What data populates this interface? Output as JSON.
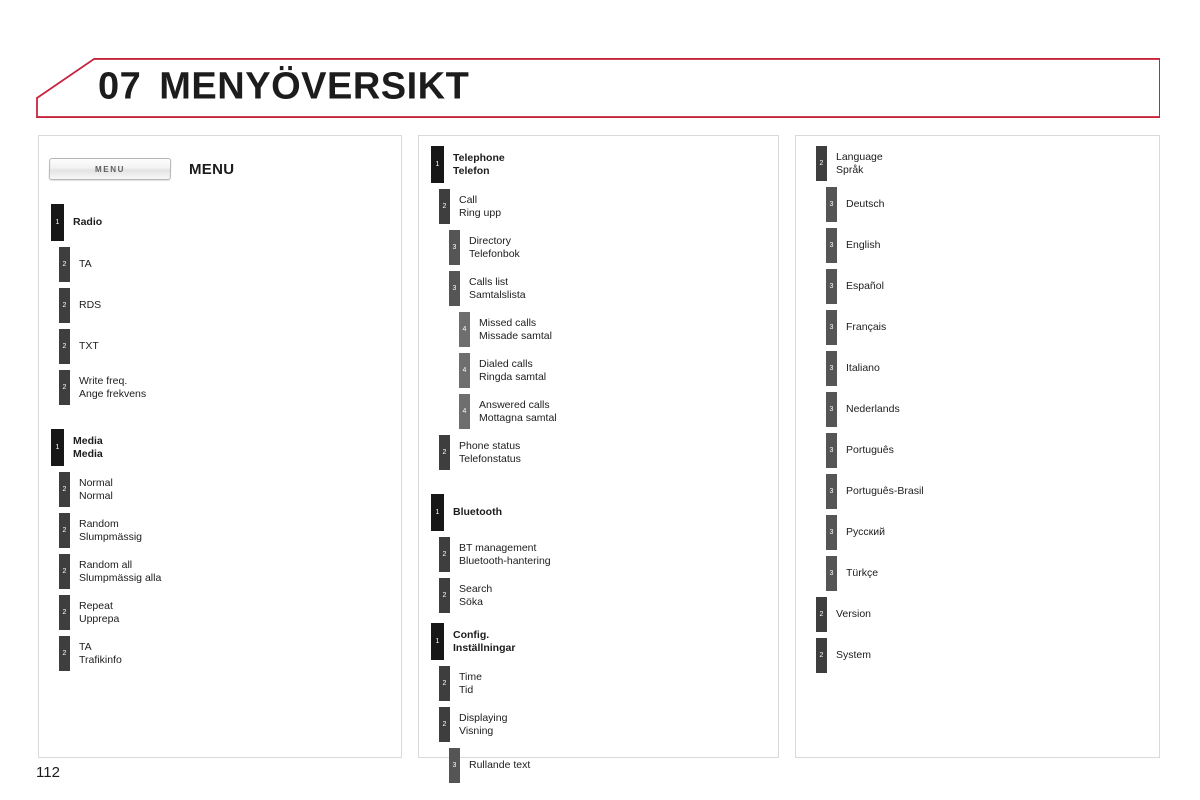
{
  "header": {
    "chapter_number": "07",
    "title": "MENYÖVERSIKT",
    "accent_color": "#c8243f"
  },
  "page_number": "112",
  "column1": {
    "menu_button_label": "MENU",
    "menu_heading": "MENU",
    "items": [
      {
        "level": 1,
        "en": "Radio",
        "sv": "",
        "gap": "none"
      },
      {
        "level": 2,
        "en": "TA",
        "sv": "",
        "gap": "none"
      },
      {
        "level": 2,
        "en": "RDS",
        "sv": "",
        "gap": "none"
      },
      {
        "level": 2,
        "en": "TXT",
        "sv": "",
        "gap": "none"
      },
      {
        "level": 2,
        "en": "Write freq.",
        "sv": "Ange frekvens",
        "gap": "none"
      },
      {
        "level": 1,
        "en": "Media",
        "sv": "Media",
        "gap": "large"
      },
      {
        "level": 2,
        "en": "Normal",
        "sv": "Normal",
        "gap": "none"
      },
      {
        "level": 2,
        "en": "Random",
        "sv": "Slumpmässig",
        "gap": "none"
      },
      {
        "level": 2,
        "en": "Random all",
        "sv": "Slumpmässig alla",
        "gap": "none"
      },
      {
        "level": 2,
        "en": "Repeat",
        "sv": "Upprepa",
        "gap": "none"
      },
      {
        "level": 2,
        "en": "TA",
        "sv": "Trafikinfo",
        "gap": "none"
      }
    ]
  },
  "column2": {
    "items": [
      {
        "level": 1,
        "en": "Telephone",
        "sv": "Telefon",
        "gap": "none"
      },
      {
        "level": 2,
        "en": "Call",
        "sv": "Ring upp",
        "gap": "none"
      },
      {
        "level": 3,
        "en": "Directory",
        "sv": "Telefonbok",
        "gap": "none"
      },
      {
        "level": 3,
        "en": "Calls list",
        "sv": "Samtalslista",
        "gap": "none"
      },
      {
        "level": 4,
        "en": "Missed calls",
        "sv": "Missade samtal",
        "gap": "none"
      },
      {
        "level": 4,
        "en": "Dialed calls",
        "sv": "Ringda samtal",
        "gap": "none"
      },
      {
        "level": 4,
        "en": "Answered calls",
        "sv": "Mottagna samtal",
        "gap": "none"
      },
      {
        "level": 2,
        "en": "Phone status",
        "sv": "Telefonstatus",
        "gap": "none"
      },
      {
        "level": 1,
        "en": "Bluetooth",
        "sv": "",
        "gap": "large"
      },
      {
        "level": 2,
        "en": "BT management",
        "sv": "Bluetooth-hantering",
        "gap": "none"
      },
      {
        "level": 2,
        "en": "Search",
        "sv": "Söka",
        "gap": "none"
      },
      {
        "level": 1,
        "en": "Config.",
        "sv": "Inställningar",
        "gap": "small"
      },
      {
        "level": 2,
        "en": "Time",
        "sv": "Tid",
        "gap": "none"
      },
      {
        "level": 2,
        "en": "Displaying",
        "sv": "Visning",
        "gap": "none"
      },
      {
        "level": 3,
        "en": "Rullande text",
        "sv": "",
        "gap": "none"
      }
    ]
  },
  "column3": {
    "items": [
      {
        "level": 2,
        "en": "Language",
        "sv": "Språk",
        "gap": "none"
      },
      {
        "level": 3,
        "en": "Deutsch",
        "sv": "",
        "gap": "none"
      },
      {
        "level": 3,
        "en": "English",
        "sv": "",
        "gap": "none"
      },
      {
        "level": 3,
        "en": "Español",
        "sv": "",
        "gap": "none"
      },
      {
        "level": 3,
        "en": "Français",
        "sv": "",
        "gap": "none"
      },
      {
        "level": 3,
        "en": "Italiano",
        "sv": "",
        "gap": "none"
      },
      {
        "level": 3,
        "en": "Nederlands",
        "sv": "",
        "gap": "none"
      },
      {
        "level": 3,
        "en": "Português",
        "sv": "",
        "gap": "none"
      },
      {
        "level": 3,
        "en": "Português-Brasil",
        "sv": "",
        "gap": "none"
      },
      {
        "level": 3,
        "en": "Русский",
        "sv": "",
        "gap": "none"
      },
      {
        "level": 3,
        "en": "Türkçe",
        "sv": "",
        "gap": "none"
      },
      {
        "level": 2,
        "en": "Version",
        "sv": "",
        "gap": "none"
      },
      {
        "level": 2,
        "en": "System",
        "sv": "",
        "gap": "none"
      }
    ]
  },
  "level_colors": {
    "1": "#171717",
    "2": "#3e3e3e",
    "3": "#555555",
    "4": "#6e6e6e"
  }
}
